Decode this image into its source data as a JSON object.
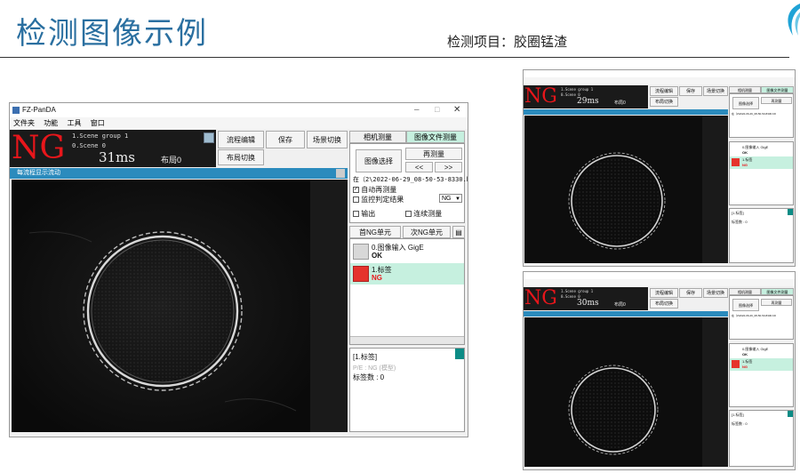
{
  "slide": {
    "title": "检测图像示例",
    "subtitle": "检测项目：胶圈锰渣"
  },
  "colors": {
    "title": "#2a6fa0",
    "ng": "#e8161b",
    "flowbar": "#2b8bbd",
    "selected_row": "#c6f0df",
    "teal": "#0c8c86"
  },
  "main_window": {
    "app_title": "FZ-PanDA",
    "window_controls": [
      "–",
      "□",
      "✕"
    ],
    "menu": [
      "文件夹",
      "功能",
      "工具",
      "窗口"
    ],
    "result": "NG",
    "scene_group": "1.Scene group 1",
    "scene": "0.Scene 0",
    "time": "31ms",
    "layout": "布局0",
    "buttons": {
      "flow_edit": "流程编辑",
      "save": "保存",
      "scene_switch": "场景切换",
      "layout_switch": "布局切换"
    },
    "flow_display_label": "每流程显示流动",
    "tabs": {
      "camera": "相机测量",
      "image_file": "图像文件测量"
    },
    "image_select": "图像选择",
    "remeasure": "再测量",
    "prev": "<<",
    "next": ">>",
    "file_path": "在（2\\2022-06-29_08-50-53-8330.bfz",
    "auto_remeasure": "自动再测量",
    "monitor_judge": "监控判定结果",
    "judge_value": "NG",
    "output": "输出",
    "continuous": "连续测量",
    "unit_tabs": {
      "first_ng": "首NG单元",
      "next_ng": "次NG单元"
    },
    "units": [
      {
        "name": "0.图像输入 GigE",
        "status": "OK"
      },
      {
        "name": "1.标签",
        "status": "NG"
      }
    ],
    "detail": {
      "title": "[1.标签]",
      "fine": "P/E : NG (模型)",
      "count": "标签数 : 0"
    }
  },
  "thumb_top": {
    "result": "NG",
    "scene_group": "1.Scene group 1",
    "scene": "0.Scene 0",
    "time": "29ms",
    "layout": "布局0",
    "buttons": {
      "flow_edit": "流程编辑",
      "save": "保存",
      "scene_switch": "场景切换",
      "layout_switch": "布局切换"
    },
    "tabs": {
      "camera": "相机测量",
      "image_file": "图像文件测量"
    },
    "image_select": "图像选择",
    "remeasure": "再测量",
    "file_path": "在（2\\2022-06-29_08-50-53-8330.bfz",
    "units": [
      {
        "name": "0.图像输入 GigE",
        "status": "OK"
      },
      {
        "name": "1.标签",
        "status": "NG"
      }
    ],
    "detail": {
      "title": "[1.标签]",
      "count": "标签数 : 0"
    }
  },
  "thumb_bottom": {
    "result": "NG",
    "scene_group": "1.Scene group 1",
    "scene": "0.Scene 0",
    "time": "30ms",
    "layout": "布局0",
    "buttons": {
      "flow_edit": "流程编辑",
      "save": "保存",
      "scene_switch": "场景切换",
      "layout_switch": "布局切换"
    },
    "tabs": {
      "camera": "相机测量",
      "image_file": "图像文件测量"
    },
    "image_select": "图像选择",
    "remeasure": "再测量",
    "file_path": "在（2\\2022-06-29_08-50-53-8330.bfz",
    "units": [
      {
        "name": "0.图像输入 GigE",
        "status": "OK"
      },
      {
        "name": "1.标签",
        "status": "NG"
      }
    ],
    "detail": {
      "title": "[1.标签]",
      "count": "标签数 : 0"
    }
  }
}
